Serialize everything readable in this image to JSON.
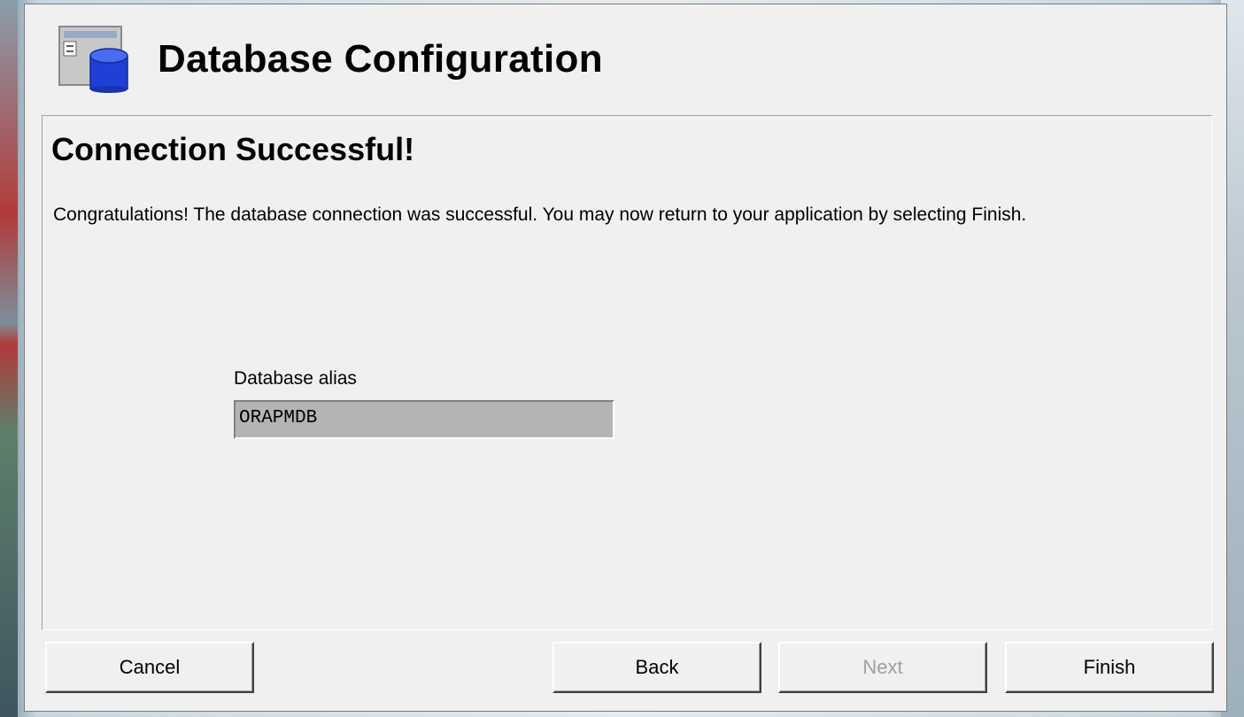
{
  "dialog": {
    "title": "Database Configuration",
    "icon": "database-config-icon"
  },
  "page": {
    "heading": "Connection Successful!",
    "message": "Congratulations!  The database connection was successful.  You may now return to your application by selecting Finish."
  },
  "alias": {
    "label": "Database alias",
    "value": "ORAPMDB"
  },
  "buttons": {
    "cancel": "Cancel",
    "back": "Back",
    "next": "Next",
    "finish": "Finish"
  },
  "colors": {
    "window_bg": "#f0f0f0",
    "field_bg": "#b4b4b4",
    "icon_blue": "#1f3fd6",
    "disabled_text": "#a0a0a0"
  }
}
